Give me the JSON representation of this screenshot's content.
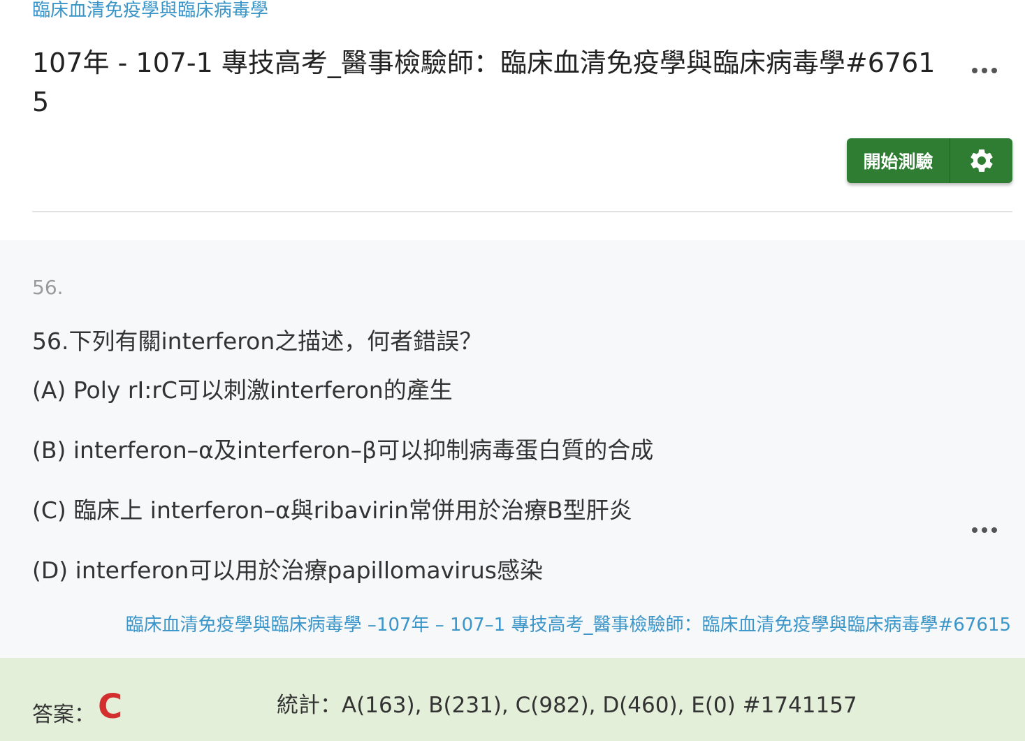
{
  "header": {
    "subject_link": "臨床血清免疫學與臨床病毒學",
    "exam_title": "107年 - 107-1 專技高考_醫事檢驗師：臨床血清免疫學與臨床病毒學#67615",
    "start_button_label": "開始測驗",
    "gear_icon": "gear-icon",
    "more_icon": "more-horizontal-icon"
  },
  "question": {
    "number_label": "56.",
    "text": "56.下列有關interferon之描述，何者錯誤？",
    "options": [
      {
        "label": "(A) Poly rI:rC可以刺激interferon的產生"
      },
      {
        "label": "(B) interferon–α及interferon–β可以抑制病毒蛋白質的合成"
      },
      {
        "label": "(C) 臨床上 interferon–α與ribavirin常併用於治療B型肝炎"
      },
      {
        "label": "(D) interferon可以用於治療papillomavirus感染"
      }
    ],
    "source_link": "臨床血清免疫學與臨床病毒學 –107年 – 107–1 專技高考_醫事檢驗師：臨床血清免疫學與臨床病毒學#67615"
  },
  "answer": {
    "label": "答案：",
    "value": "C",
    "stats": "統計：A(163), B(231), C(982), D(460), E(0) #1741157"
  },
  "colors": {
    "link": "#3a95c9",
    "button_green": "#2e7d32",
    "answer_red": "#d32f2f",
    "answer_bg": "#e3efd9",
    "question_bg": "#f7f8fa"
  }
}
